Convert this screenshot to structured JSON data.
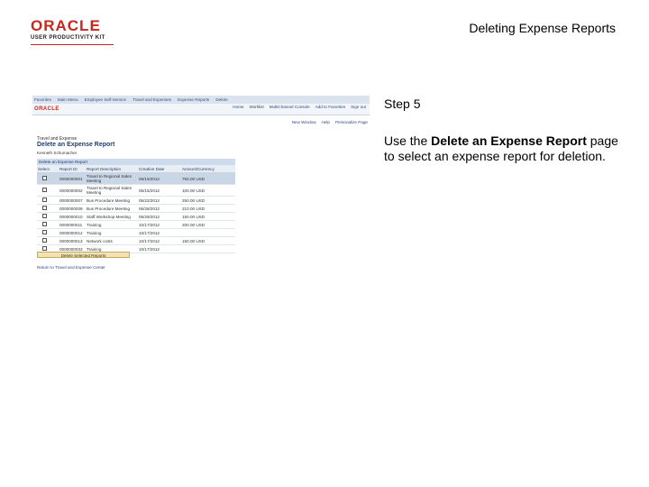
{
  "header": {
    "logo_text": "ORACLE",
    "logo_subtext": "USER PRODUCTIVITY KIT",
    "document_title": "Deleting Expense Reports"
  },
  "screenshot": {
    "nav_links": [
      "Favorites",
      "Main Menu",
      "Employee Self-Service",
      "Travel and Expenses",
      "Expense Reports",
      "Delete"
    ],
    "brand": "ORACLE",
    "top_links": [
      "Home",
      "Worklist",
      "MultiChannel Console",
      "Add to Favorites",
      "Sign out"
    ],
    "page_links": [
      "New Window",
      "Help",
      "Personalize Page"
    ],
    "breadcrumb": "Travel and Expense",
    "page_title": "Delete an Expense Report",
    "employee_name": "Kenneth Schumacher",
    "grid_title": "Delete an Expense Report",
    "columns": [
      "Select",
      "Report ID",
      "Report Description",
      "Creation Date",
      "Amount/Currency"
    ],
    "rows": [
      {
        "id": "0000000001",
        "desc": "Travel to Regional Sales Meeting",
        "date": "06/15/2012",
        "amount": "750.00 USD",
        "selected": true
      },
      {
        "id": "0000000002",
        "desc": "Travel to Regional Sales Meeting",
        "date": "06/15/2012",
        "amount": "100.00 USD",
        "selected": false
      },
      {
        "id": "0000000007",
        "desc": "Bus Procedure Meeting",
        "date": "06/22/2012",
        "amount": "250.00 USD",
        "selected": false
      },
      {
        "id": "0000000009",
        "desc": "Bus Procedure Meeting",
        "date": "06/28/2012",
        "amount": "210.00 USD",
        "selected": false
      },
      {
        "id": "0000000010",
        "desc": "Staff Workshop Meeting",
        "date": "06/29/2012",
        "amount": "150.00 USD",
        "selected": false
      },
      {
        "id": "0000000011",
        "desc": "Training",
        "date": "10/17/2012",
        "amount": "200.00 USD",
        "selected": false
      },
      {
        "id": "0000000012",
        "desc": "Training",
        "date": "10/17/2012",
        "amount": "",
        "selected": false
      },
      {
        "id": "0000000013",
        "desc": "Network costs",
        "date": "10/17/2012",
        "amount": "150.00 USD",
        "selected": false
      },
      {
        "id": "0000000033",
        "desc": "Training",
        "date": "10/17/2012",
        "amount": "",
        "selected": false
      }
    ],
    "delete_button": "Delete Selected Reports",
    "return_link": "Return to Travel and Expense Center"
  },
  "instruction": {
    "step_label": "Step 5",
    "text_before": "Use the ",
    "text_bold": "Delete an Expense Report",
    "text_after": " page to select an expense report for deletion."
  }
}
